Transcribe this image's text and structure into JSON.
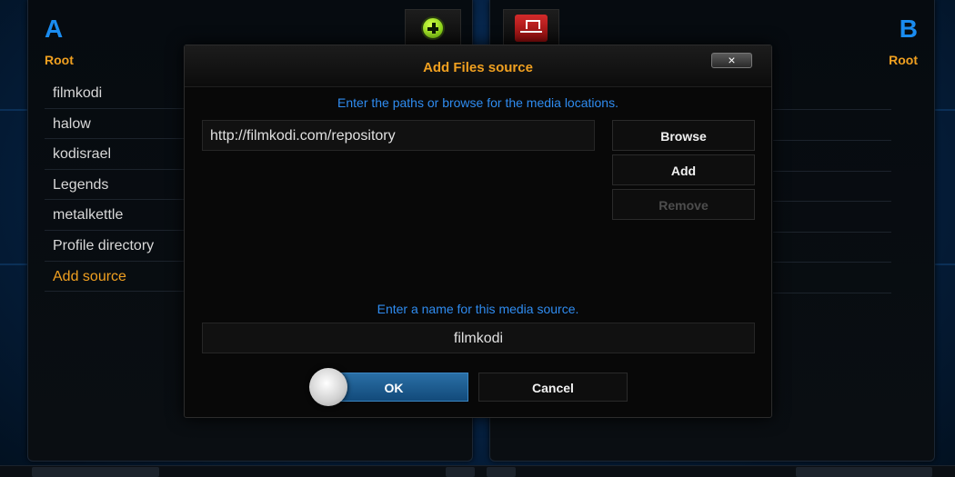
{
  "left_panel": {
    "letter": "A",
    "subtitle": "Root",
    "items": [
      {
        "label": "filmkodi"
      },
      {
        "label": "halow"
      },
      {
        "label": "kodisrael"
      },
      {
        "label": "Legends"
      },
      {
        "label": "metalkettle"
      },
      {
        "label": "Profile directory"
      },
      {
        "label": "Add source"
      }
    ],
    "active_item": "Add source"
  },
  "right_panel": {
    "letter": "B",
    "subtitle": "Root"
  },
  "toolbar": {
    "add_icon": "add-circle-icon",
    "network_icon": "network-icon"
  },
  "dialog": {
    "title": "Add Files source",
    "close_label": "×",
    "path_hint": "Enter the paths or browse for the media locations.",
    "path_value": "http://filmkodi.com/repository",
    "browse_label": "Browse",
    "add_label": "Add",
    "remove_label": "Remove",
    "name_hint": "Enter a name for this media source.",
    "name_value": "filmkodi",
    "ok_label": "OK",
    "cancel_label": "Cancel"
  },
  "colors": {
    "accent": "#f0a020",
    "hint": "#2f8cf0",
    "letter": "#1a8cf0"
  }
}
